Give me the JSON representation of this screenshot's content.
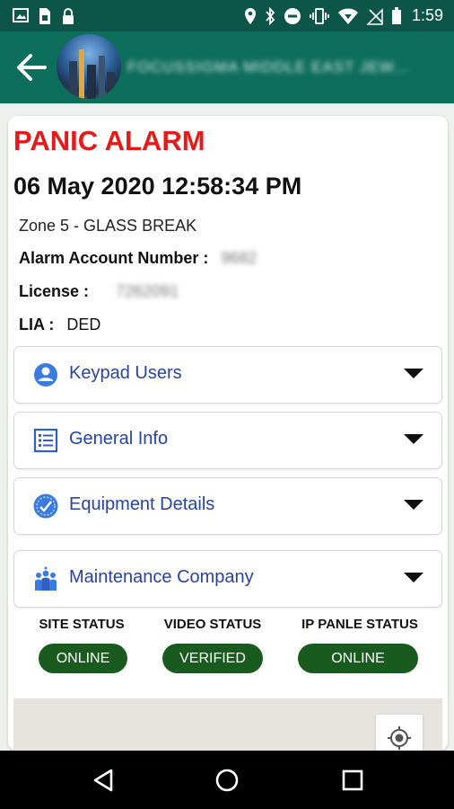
{
  "status_bar": {
    "time": "1:59",
    "left_icons": [
      "image-icon",
      "sim-card-icon",
      "lock-icon"
    ],
    "right_icons": [
      "location-icon",
      "bluetooth-icon",
      "do-not-disturb-icon",
      "vibrate-icon",
      "wifi-icon",
      "no-signal-icon",
      "battery-icon"
    ]
  },
  "app_bar": {
    "back_icon": "arrow-back-icon",
    "title": "FOCUSSIGMA MIDDLE EAST JEW..."
  },
  "alarm": {
    "title": "PANIC ALARM",
    "datetime": "06 May 2020 12:58:34 PM",
    "zone": "Zone 5 - GLASS BREAK",
    "account_label": "Alarm Account Number :",
    "account_value": "9682",
    "license_label": "License :",
    "license_value": "7262091",
    "lia_label": "LIA :",
    "lia_value": "DED"
  },
  "sections": [
    {
      "label": "Keypad Users",
      "icon": "user-circle-icon"
    },
    {
      "label": "General Info",
      "icon": "list-icon"
    },
    {
      "label": "Equipment Details",
      "icon": "equipment-badge-icon"
    },
    {
      "label": "Maintenance Company",
      "icon": "team-icon"
    }
  ],
  "statuses": [
    {
      "label": "SITE STATUS",
      "value": "ONLINE"
    },
    {
      "label": "VIDEO STATUS",
      "value": "VERIFIED"
    },
    {
      "label": "IP PANLE STATUS",
      "value": "ONLINE"
    }
  ],
  "map": {
    "locate_icon": "my-location-icon"
  },
  "nav_bar": {
    "icons": [
      "back-triangle-icon",
      "home-circle-icon",
      "recents-square-icon"
    ]
  },
  "colors": {
    "status_bar": "#0c5548",
    "app_bar": "#0e6e5c",
    "alarm_red": "#e31b1b",
    "section_label": "#2544a6",
    "pill_green": "#195a1f"
  }
}
